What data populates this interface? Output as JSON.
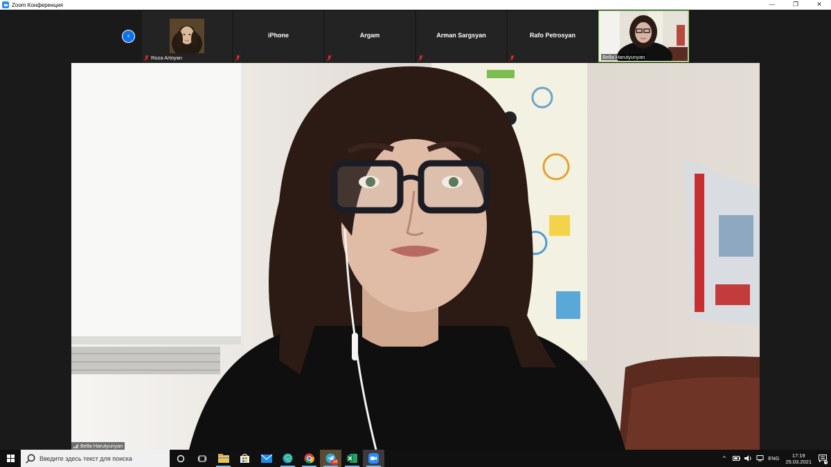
{
  "window": {
    "title": "Zoom Конференция",
    "controls": {
      "minimize": "—",
      "restore": "❐",
      "close": "✕"
    }
  },
  "gallery": {
    "prev_arrow": "‹",
    "tiles": [
      {
        "name": "Roza Artoyan",
        "label": "Roza Artoyan",
        "muted": true,
        "has_video": true
      },
      {
        "name": "iPhone",
        "muted": true,
        "has_video": false
      },
      {
        "name": "Argam",
        "muted": true,
        "has_video": false
      },
      {
        "name": "Arman Sargsyan",
        "muted": true,
        "has_video": false
      },
      {
        "name": "Rafo Petrosyan",
        "muted": true,
        "has_video": false
      },
      {
        "name": "Bella Harutyunyan",
        "label": "Bella Harutyunyan",
        "muted": false,
        "has_video": true,
        "active_speaker": true
      }
    ]
  },
  "main_video": {
    "speaker_label": "Bella Harutyunyan"
  },
  "taskbar": {
    "search_placeholder": "Введите здесь текст для поиска",
    "telegram_badge": "14",
    "tray": {
      "chevron": "^",
      "language": "ENG",
      "time": "17:19",
      "date": "25.03.2021",
      "notification_count": "4"
    }
  }
}
